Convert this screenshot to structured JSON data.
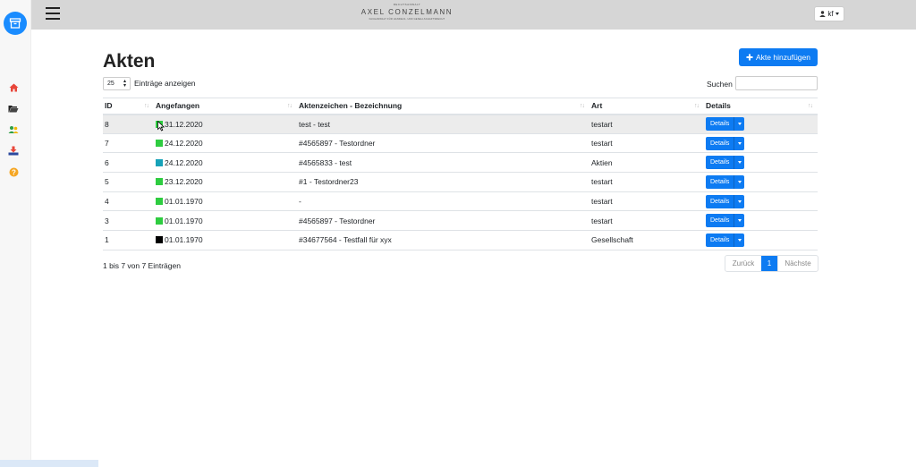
{
  "header": {
    "logo_small": "RECHTSANWALT",
    "logo_main": "AXEL CONZELMANN",
    "logo_sub": "FACHANWALT FÜR HANDELS- UND GESELLSCHAFTSRECHT",
    "user_label": "kf"
  },
  "sidebar": {
    "icons": [
      "home-icon",
      "folder-open-icon",
      "users-icon",
      "download-icon",
      "help-icon"
    ]
  },
  "main": {
    "title": "Akten",
    "add_button": "Akte hinzufügen",
    "page_length": "25",
    "page_length_label": "Einträge anzeigen",
    "search_label": "Suchen",
    "search_value": ""
  },
  "table": {
    "columns": [
      "ID",
      "Angefangen",
      "Aktenzeichen - Bezeichnung",
      "Art",
      "Details"
    ],
    "rows": [
      {
        "id": "8",
        "date": "31.12.2020",
        "color": "#2ecc40",
        "title": "test - test",
        "art": "testart",
        "details": "Details"
      },
      {
        "id": "7",
        "date": "24.12.2020",
        "color": "#2ecc40",
        "title": "#4565897 - Testordner",
        "art": "testart",
        "details": "Details"
      },
      {
        "id": "6",
        "date": "24.12.2020",
        "color": "#17a2b8",
        "title": "#4565833 - test",
        "art": "Aktien",
        "details": "Details"
      },
      {
        "id": "5",
        "date": "23.12.2020",
        "color": "#2ecc40",
        "title": "#1 - Testordner23",
        "art": "testart",
        "details": "Details"
      },
      {
        "id": "4",
        "date": "01.01.1970",
        "color": "#2ecc40",
        "title": "-",
        "art": "testart",
        "details": "Details"
      },
      {
        "id": "3",
        "date": "01.01.1970",
        "color": "#2ecc40",
        "title": "#4565897 - Testordner",
        "art": "testart",
        "details": "Details"
      },
      {
        "id": "1",
        "date": "01.01.1970",
        "color": "#000000",
        "title": "#34677564 - Testfall für xyx",
        "art": "Gesellschaft",
        "details": "Details"
      }
    ]
  },
  "footer": {
    "info": "1 bis 7 von 7 Einträgen",
    "prev": "Zurück",
    "current_page": "1",
    "next": "Nächste"
  },
  "colors": {
    "primary": "#0d7bf2",
    "topbar": "#d6d6d6"
  }
}
